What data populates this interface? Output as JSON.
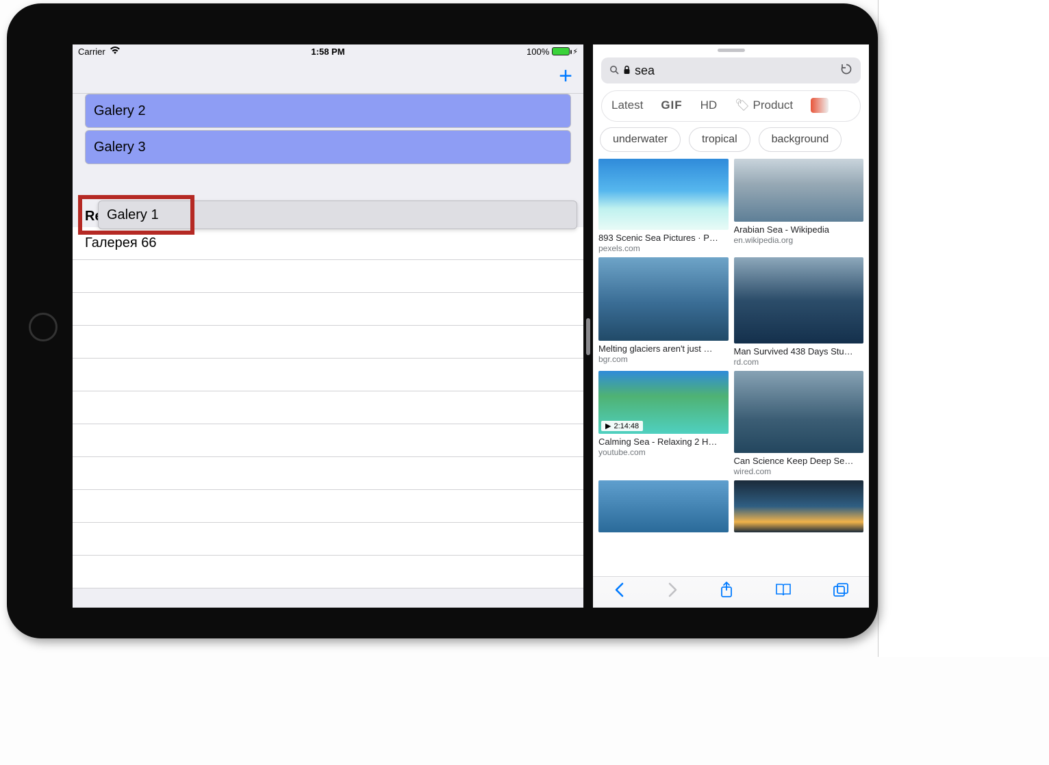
{
  "status": {
    "carrier": "Carrier",
    "time": "1:58 PM",
    "battery_pct": "100%"
  },
  "nav": {
    "add_label": "+"
  },
  "galleries": {
    "items": [
      {
        "label": "Galery 2"
      },
      {
        "label": "Galery 3"
      }
    ],
    "dragging": {
      "label": "Galery 1"
    }
  },
  "sections": {
    "recently_deleted_header": "Recently Deleted",
    "recently_deleted_items": [
      {
        "label": "Галерея 66"
      }
    ]
  },
  "safari": {
    "url_display": "sea",
    "filters": {
      "latest": "Latest",
      "gif": "GIF",
      "hd": "HD",
      "product": "Product"
    },
    "chips": [
      "underwater",
      "tropical",
      "background"
    ],
    "results": [
      {
        "title": "893 Scenic Sea Pictures · P…",
        "source": "pexels.com"
      },
      {
        "title": "Arabian Sea - Wikipedia",
        "source": "en.wikipedia.org"
      },
      {
        "title": "Melting glaciers aren't just …",
        "source": "bgr.com"
      },
      {
        "title": "Man Survived 438 Days Stu…",
        "source": "rd.com"
      },
      {
        "title": "Calming Sea - Relaxing 2 H…",
        "source": "youtube.com",
        "video_time": "2:14:48"
      },
      {
        "title": "Can Science Keep Deep Se…",
        "source": "wired.com"
      },
      {
        "title": "",
        "source": ""
      },
      {
        "title": "",
        "source": ""
      }
    ]
  }
}
